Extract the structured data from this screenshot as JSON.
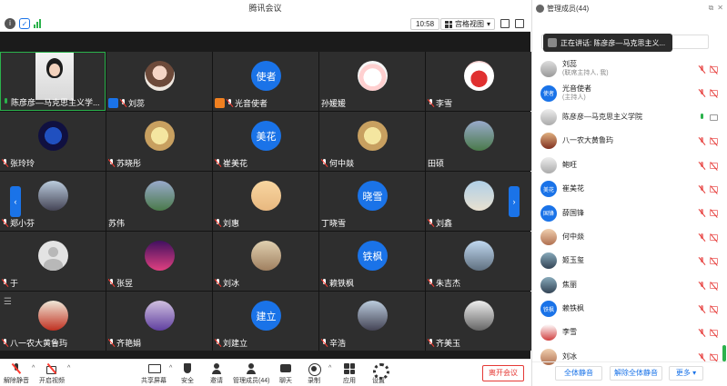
{
  "window": {
    "title": "腾讯会议"
  },
  "toolbar": {
    "time": "10:58",
    "view_label": "宫格视图"
  },
  "grid": {
    "tiles": [
      {
        "name": "陈彦彦—马克思主义学...",
        "mic": "on",
        "avatar_text": "",
        "badge": ""
      },
      {
        "name": "刘蕊",
        "mic": "off",
        "avatar_text": "",
        "badge": "blue"
      },
      {
        "name": "光音使者",
        "mic": "off",
        "avatar_text": "使者",
        "badge": "orange"
      },
      {
        "name": "孙媛媛",
        "mic": "none",
        "avatar_text": "",
        "badge": ""
      },
      {
        "name": "李雪",
        "mic": "off",
        "avatar_text": "",
        "badge": ""
      },
      {
        "name": "张玲玲",
        "mic": "off",
        "avatar_text": "",
        "badge": ""
      },
      {
        "name": "苏晓彤",
        "mic": "off",
        "avatar_text": "",
        "badge": ""
      },
      {
        "name": "崔美花",
        "mic": "off",
        "avatar_text": "美花",
        "badge": ""
      },
      {
        "name": "何中燚",
        "mic": "off",
        "avatar_text": "",
        "badge": ""
      },
      {
        "name": "田硕",
        "mic": "none",
        "avatar_text": "",
        "badge": ""
      },
      {
        "name": "郑小芬",
        "mic": "off",
        "avatar_text": "",
        "badge": ""
      },
      {
        "name": "苏伟",
        "mic": "none",
        "avatar_text": "",
        "badge": ""
      },
      {
        "name": "刘惠",
        "mic": "off",
        "avatar_text": "",
        "badge": ""
      },
      {
        "name": "丁晓雪",
        "mic": "none",
        "avatar_text": "晓雪",
        "badge": ""
      },
      {
        "name": "刘鑫",
        "mic": "off",
        "avatar_text": "",
        "badge": ""
      },
      {
        "name": "于",
        "mic": "off",
        "avatar_text": "",
        "badge": ""
      },
      {
        "name": "张昱",
        "mic": "off",
        "avatar_text": "",
        "badge": ""
      },
      {
        "name": "刘冰",
        "mic": "off",
        "avatar_text": "",
        "badge": ""
      },
      {
        "name": "赖铁枫",
        "mic": "off",
        "avatar_text": "铁枫",
        "badge": ""
      },
      {
        "name": "朱吉杰",
        "mic": "off",
        "avatar_text": "",
        "badge": ""
      },
      {
        "name": "八一农大黄鲁玙",
        "mic": "off",
        "avatar_text": "",
        "badge": ""
      },
      {
        "name": "齐艳娟",
        "mic": "off",
        "avatar_text": "",
        "badge": ""
      },
      {
        "name": "刘建立",
        "mic": "off",
        "avatar_text": "建立",
        "badge": ""
      },
      {
        "name": "辛浩",
        "mic": "off",
        "avatar_text": "",
        "badge": ""
      },
      {
        "name": "齐美玉",
        "mic": "off",
        "avatar_text": "",
        "badge": ""
      }
    ]
  },
  "controls": {
    "unmute": "解除静音",
    "start_video": "开启视频",
    "share_screen": "共享屏幕",
    "security": "安全",
    "invite": "邀请",
    "members": "管理成员(44)",
    "chat": "聊天",
    "record": "录制",
    "apps": "应用",
    "settings": "设置",
    "leave": "离开会议"
  },
  "panel": {
    "title": "管理成员(44)",
    "speaking_tip": "正在讲话: 陈彦彦—马克思主义...",
    "members": [
      {
        "name": "刘蕊",
        "sub": "(联席主持人, 我)",
        "avatar_text": "",
        "mic": "off",
        "cam": "off"
      },
      {
        "name": "光音使者",
        "sub": "(主持人)",
        "avatar_text": "使者",
        "mic": "off",
        "cam": "off"
      },
      {
        "name": "陈彦彦—马克思主义学院",
        "sub": "",
        "avatar_text": "",
        "mic": "on",
        "cam": "on"
      },
      {
        "name": "八一农大黄鲁玙",
        "sub": "",
        "avatar_text": "",
        "mic": "off",
        "cam": "off"
      },
      {
        "name": "鲍旺",
        "sub": "",
        "avatar_text": "",
        "mic": "off",
        "cam": "off"
      },
      {
        "name": "崔美花",
        "sub": "",
        "avatar_text": "美花",
        "mic": "off",
        "cam": "off"
      },
      {
        "name": "薛国锋",
        "sub": "",
        "avatar_text": "国锋",
        "mic": "off",
        "cam": "off"
      },
      {
        "name": "何中燚",
        "sub": "",
        "avatar_text": "",
        "mic": "off",
        "cam": "off"
      },
      {
        "name": "姬玉玺",
        "sub": "",
        "avatar_text": "",
        "mic": "off",
        "cam": "off"
      },
      {
        "name": "焦丽",
        "sub": "",
        "avatar_text": "",
        "mic": "off",
        "cam": "off"
      },
      {
        "name": "赖铁枫",
        "sub": "",
        "avatar_text": "铁枫",
        "mic": "off",
        "cam": "off"
      },
      {
        "name": "李雪",
        "sub": "",
        "avatar_text": "",
        "mic": "off",
        "cam": "off"
      },
      {
        "name": "刘冰",
        "sub": "",
        "avatar_text": "",
        "mic": "off",
        "cam": "off"
      }
    ],
    "mute_all": "全体静音",
    "unmute_all": "解除全体静音",
    "more": "更多"
  }
}
